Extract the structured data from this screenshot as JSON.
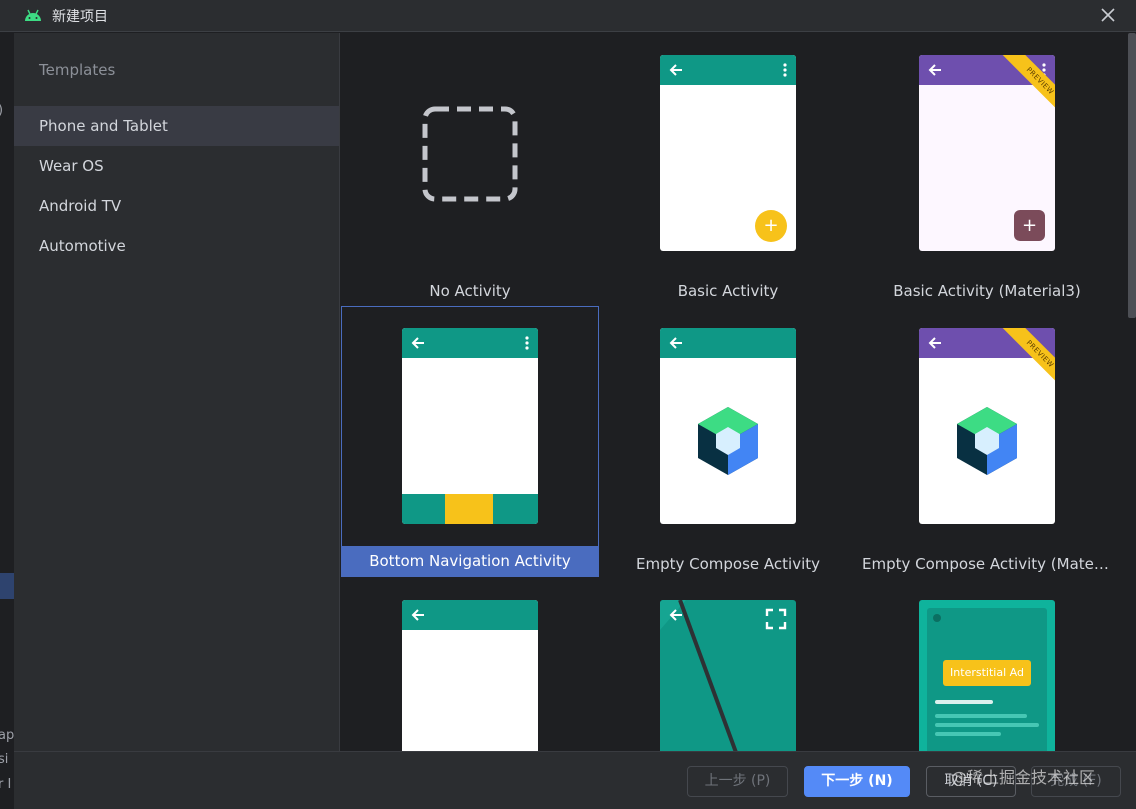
{
  "window": {
    "title": "新建项目",
    "app_icon": "android-icon",
    "close_icon": "close-icon"
  },
  "background_fragments": [
    ")",
    "ap",
    "si",
    "r I"
  ],
  "sidebar": {
    "heading": "Templates",
    "items": [
      {
        "label": "Phone and Tablet",
        "active": true
      },
      {
        "label": "Wear OS",
        "active": false
      },
      {
        "label": "Android TV",
        "active": false
      },
      {
        "label": "Automotive",
        "active": false
      }
    ]
  },
  "templates": [
    {
      "label": "No Activity",
      "selected": false
    },
    {
      "label": "Basic Activity",
      "selected": false
    },
    {
      "label": "Basic Activity (Material3)",
      "selected": false,
      "badge": "PREVIEW"
    },
    {
      "label": "Bottom Navigation Activity",
      "selected": true
    },
    {
      "label": "Empty Compose Activity",
      "selected": false
    },
    {
      "label": "Empty Compose Activity (Material...",
      "selected": false,
      "badge": "PREVIEW"
    },
    {
      "label": "",
      "selected": false
    },
    {
      "label": "",
      "selected": false
    },
    {
      "label": "",
      "selected": false,
      "ad_text": "Interstitial Ad"
    }
  ],
  "footer": {
    "prev_label": "上一步 (P)",
    "next_label": "下一步 (N)",
    "cancel_label": "取消 (C)",
    "finish_label": "完成 (F)",
    "watermark": "@稀土掘金技术社区"
  },
  "colors": {
    "accent": "#548af7",
    "selection": "#4a6cbf",
    "teal": "#0f9886",
    "purple": "#6e4fae",
    "yellow": "#f7c21a"
  }
}
